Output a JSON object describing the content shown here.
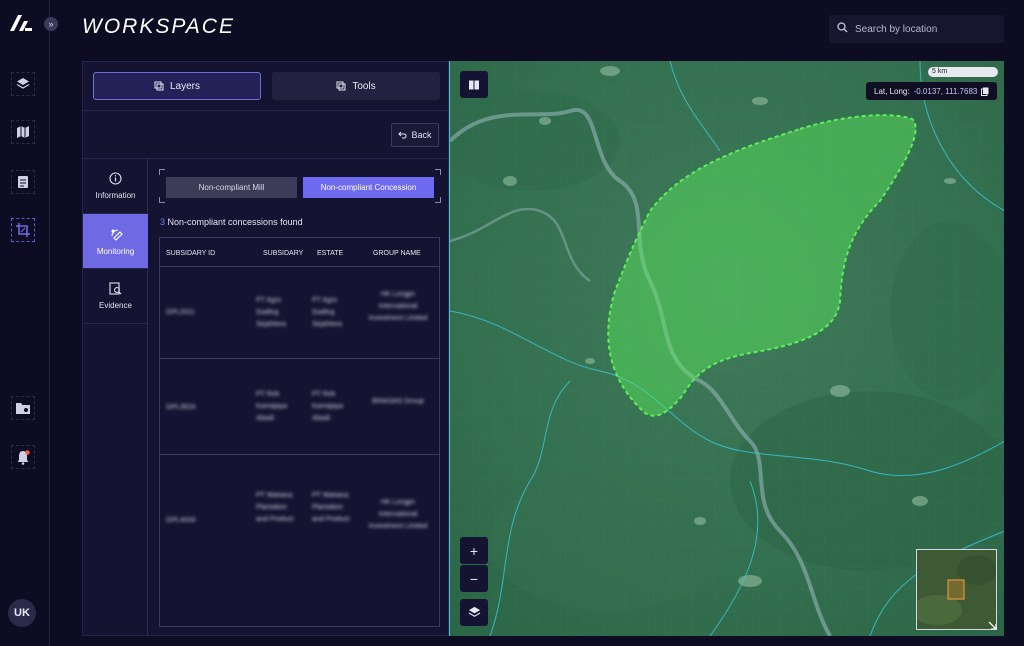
{
  "app": {
    "title": "WORKSPACE",
    "expand_glyph": "»"
  },
  "search": {
    "placeholder": "Search by location"
  },
  "rail": {
    "items": [
      {
        "name": "layers-icon"
      },
      {
        "name": "map-icon"
      },
      {
        "name": "document-icon"
      },
      {
        "name": "crop-icon",
        "active": true
      },
      {
        "name": "folder-settings-icon"
      },
      {
        "name": "notification-bell-icon"
      }
    ],
    "user_initials": "UK"
  },
  "panel": {
    "tabs": [
      {
        "label": "Layers",
        "active": true
      },
      {
        "label": "Tools",
        "active": false
      }
    ],
    "back_label": "Back",
    "side_nav": [
      {
        "label": "Information",
        "icon": "info-icon",
        "active": false
      },
      {
        "label": "Monitoring",
        "icon": "satellite-icon",
        "active": true
      },
      {
        "label": "Evidence",
        "icon": "evidence-icon",
        "active": false
      }
    ],
    "filters": [
      {
        "label": "Non-compliant Mill",
        "active": false
      },
      {
        "label": "Non-compliant Concession",
        "active": true
      }
    ],
    "found_count": "3",
    "found_text": " Non-compliant concessions found",
    "table": {
      "headers": [
        "SUBSIDARY ID",
        "SUBSIDARY",
        "ESTATE",
        "GROUP NAME"
      ],
      "rows": [
        {
          "id": "GPL2011",
          "subsidiary": "PT Agro Gading Sejahtera",
          "estate": "PT Agro Gading Sejahtera",
          "group": "HK Longjin International Investment Limited"
        },
        {
          "id": "GPL3524",
          "subsidiary": "PT Refi Kamajaya Abadi",
          "estate": "PT Refi Kamajaya Abadi",
          "group": "BINASAS Group"
        },
        {
          "id": "GPL4034",
          "subsidiary": "PT Wahana Plantation and Product",
          "estate": "PT Wahana Plantation and Product",
          "group": "HK Longjin International Investment Limited"
        }
      ]
    }
  },
  "map": {
    "scale_label": "5 km",
    "latlong_label": "Lat, Long:",
    "latlong_value": "-0.0137, 111.7683",
    "zoom_in": "+",
    "zoom_out": "−",
    "polygon_color": "#5df05a"
  }
}
